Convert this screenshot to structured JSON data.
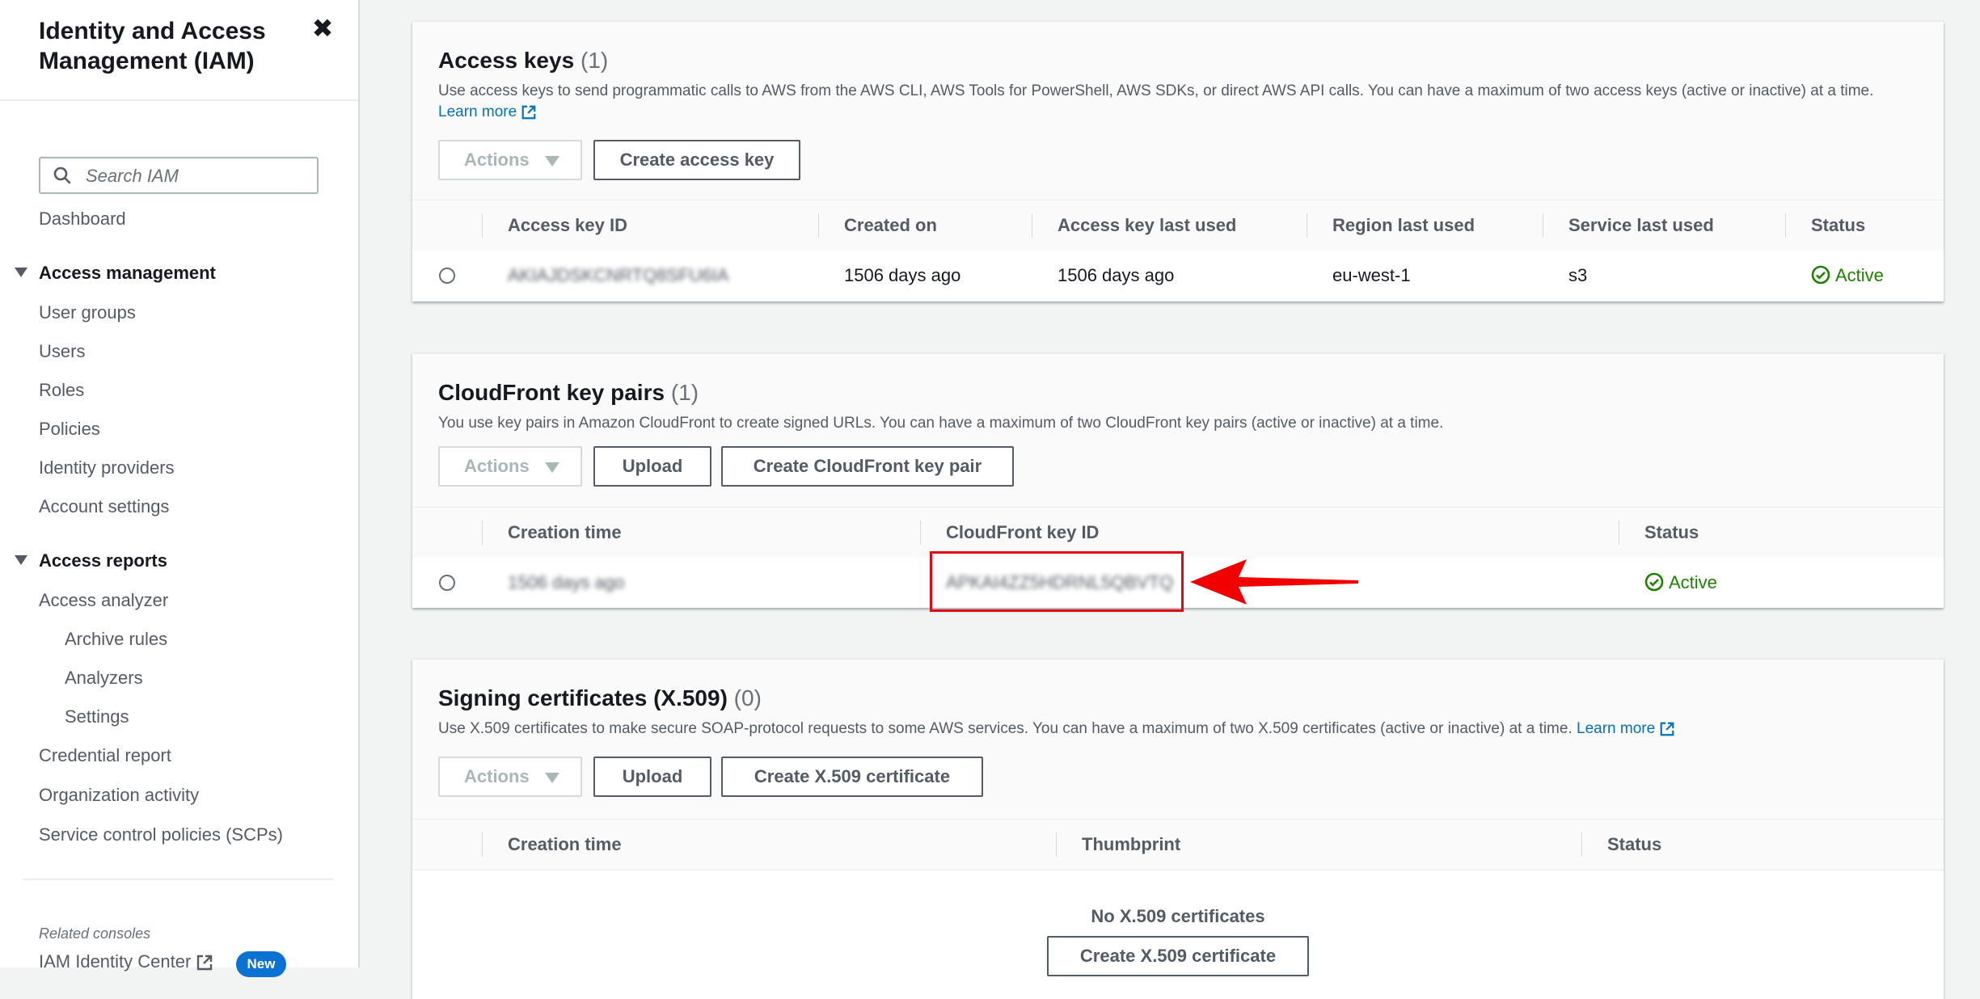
{
  "sidebar": {
    "title": "Identity and Access Management (IAM)",
    "search_placeholder": "Search IAM",
    "dashboard": "Dashboard",
    "sections": [
      {
        "label": "Access management",
        "items": [
          "User groups",
          "Users",
          "Roles",
          "Policies",
          "Identity providers",
          "Account settings"
        ]
      },
      {
        "label": "Access reports",
        "items": [
          "Access analyzer"
        ]
      }
    ],
    "analyzer_sub": [
      "Archive rules",
      "Analyzers",
      "Settings"
    ],
    "reports_more": [
      "Credential report",
      "Organization activity",
      "Service control policies (SCPs)"
    ],
    "related_consoles": "Related consoles",
    "iam_identity_center": "IAM Identity Center",
    "new_badge": "New"
  },
  "access_keys": {
    "title": "Access keys",
    "count": "(1)",
    "description": "Use access keys to send programmatic calls to AWS from the AWS CLI, AWS Tools for PowerShell, AWS SDKs, or direct AWS API calls. You can have a maximum of two access keys (active or inactive) at a time.",
    "learn_more": "Learn more",
    "actions": "Actions",
    "create": "Create access key",
    "columns": [
      "Access key ID",
      "Created on",
      "Access key last used",
      "Region last used",
      "Service last used",
      "Status"
    ],
    "rows": [
      {
        "id": "AKIAJDSKCNRTQ8SFU6IA",
        "created": "1506 days ago",
        "last_used": "1506 days ago",
        "region": "eu-west-1",
        "service": "s3",
        "status": "Active"
      }
    ]
  },
  "cloudfront": {
    "title": "CloudFront key pairs",
    "count": "(1)",
    "description": "You use key pairs in Amazon CloudFront to create signed URLs. You can have a maximum of two CloudFront key pairs (active or inactive) at a time.",
    "actions": "Actions",
    "upload": "Upload",
    "create": "Create CloudFront key pair",
    "columns": [
      "Creation time",
      "CloudFront key ID",
      "Status"
    ],
    "rows": [
      {
        "created": "1506 days ago",
        "key_id": "APKAI4ZZ5HDRNL5QBVTQ",
        "status": "Active"
      }
    ]
  },
  "signing": {
    "title": "Signing certificates (X.509)",
    "count": "(0)",
    "description": "Use X.509 certificates to make secure SOAP-protocol requests to some AWS services. You can have a maximum of two X.509 certificates (active or inactive) at a time.",
    "learn_more": "Learn more",
    "actions": "Actions",
    "upload": "Upload",
    "create": "Create X.509 certificate",
    "columns": [
      "Creation time",
      "Thumbprint",
      "Status"
    ],
    "empty": "No X.509 certificates",
    "empty_create": "Create X.509 certificate"
  },
  "colors": {
    "accent": "#0073bb",
    "success": "#1d8102",
    "highlight": "#e30613"
  }
}
